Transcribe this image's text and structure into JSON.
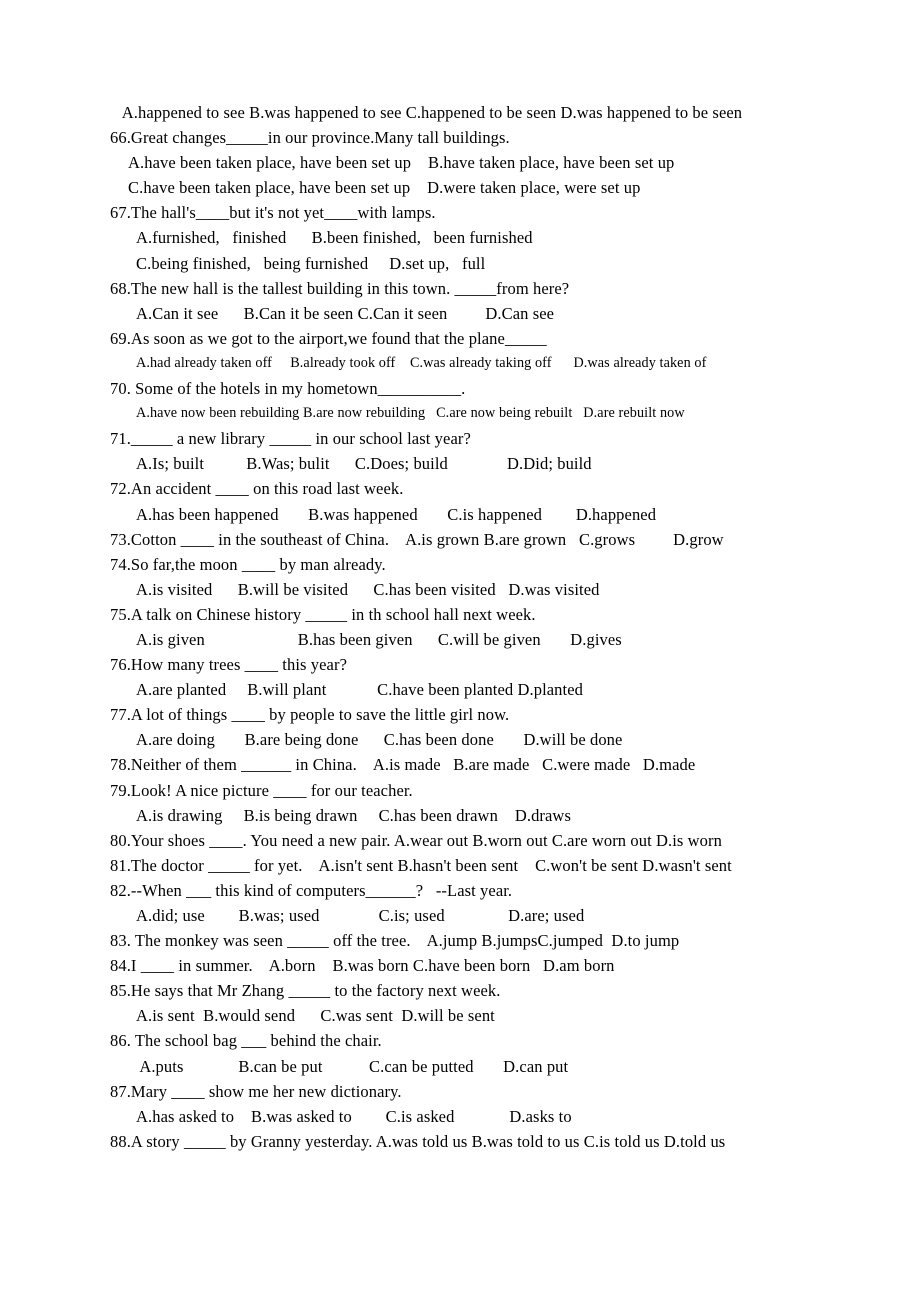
{
  "document": {
    "lines": [
      {
        "text": "   A.happened to see B.was happened to see C.happened to be seen D.was happened to be seen",
        "size": "normal",
        "indent": "none"
      },
      {
        "text": "66.Great changes_____in our province.Many tall buildings.",
        "size": "normal",
        "indent": "none"
      },
      {
        "text": "A.have been taken place, have been set up    B.have taken place, have been set up",
        "size": "normal",
        "indent": "indent1"
      },
      {
        "text": "C.have been taken place, have been set up    D.were taken place, were set up",
        "size": "normal",
        "indent": "indent1"
      },
      {
        "text": "67.The hall's____but it's not yet____with lamps.",
        "size": "normal",
        "indent": "none"
      },
      {
        "text": "A.furnished,   finished      B.been finished,   been furnished",
        "size": "normal",
        "indent": "indent2"
      },
      {
        "text": "C.being finished,   being furnished     D.set up,   full",
        "size": "normal",
        "indent": "indent2"
      },
      {
        "text": "68.The new hall is the tallest building in this town. _____from here?",
        "size": "normal",
        "indent": "none"
      },
      {
        "text": "A.Can it see      B.Can it be seen C.Can it seen         D.Can see",
        "size": "normal",
        "indent": "indent2"
      },
      {
        "text": "69.As soon as we got to the airport,we found that the plane_____",
        "size": "normal",
        "indent": "none"
      },
      {
        "text": "A.had already taken off     B.already took off    C.was already taking off      D.was already taken of",
        "size": "small",
        "indent": "indent2"
      },
      {
        "text": "70. Some of the hotels in my hometown__________.",
        "size": "normal",
        "indent": "none"
      },
      {
        "text": "A.have now been rebuilding B.are now rebuilding   C.are now being rebuilt   D.are rebuilt now",
        "size": "small",
        "indent": "indent2"
      },
      {
        "text": "71._____ a new library _____ in our school last year?",
        "size": "normal",
        "indent": "none"
      },
      {
        "text": "A.Is; built          B.Was; bulit      C.Does; build              D.Did; build",
        "size": "normal",
        "indent": "indent2"
      },
      {
        "text": "72.An accident ____ on this road last week.",
        "size": "normal",
        "indent": "none"
      },
      {
        "text": "A.has been happened       B.was happened       C.is happened        D.happened",
        "size": "normal",
        "indent": "indent2"
      },
      {
        "text": "73.Cotton ____ in the southeast of China.    A.is grown B.are grown   C.grows         D.grow",
        "size": "normal",
        "indent": "none"
      },
      {
        "text": "74.So far,the moon ____ by man already.",
        "size": "normal",
        "indent": "none"
      },
      {
        "text": "A.is visited      B.will be visited      C.has been visited   D.was visited",
        "size": "normal",
        "indent": "indent2"
      },
      {
        "text": "75.A talk on Chinese history _____ in th school hall next week.",
        "size": "normal",
        "indent": "none"
      },
      {
        "text": "A.is given                      B.has been given      C.will be given       D.gives",
        "size": "normal",
        "indent": "indent2"
      },
      {
        "text": "76.How many trees ____ this year?",
        "size": "normal",
        "indent": "none"
      },
      {
        "text": "A.are planted     B.will plant            C.have been planted D.planted",
        "size": "normal",
        "indent": "indent2"
      },
      {
        "text": "77.A lot of things ____ by people to save the little girl now.",
        "size": "normal",
        "indent": "none"
      },
      {
        "text": "A.are doing       B.are being done      C.has been done       D.will be done",
        "size": "normal",
        "indent": "indent2"
      },
      {
        "text": "78.Neither of them ______ in China.    A.is made   B.are made   C.were made   D.made",
        "size": "normal",
        "indent": "none"
      },
      {
        "text": "79.Look! A nice picture ____ for our teacher.",
        "size": "normal",
        "indent": "none"
      },
      {
        "text": "A.is drawing     B.is being drawn     C.has been drawn    D.draws",
        "size": "normal",
        "indent": "indent2"
      },
      {
        "text": "80.Your shoes ____. You need a new pair. A.wear out B.worn out C.are worn out D.is worn",
        "size": "normal",
        "indent": "none"
      },
      {
        "text": "81.The doctor _____ for yet.    A.isn't sent B.hasn't been sent    C.won't be sent D.wasn't sent",
        "size": "normal",
        "indent": "none"
      },
      {
        "text": "82.--When ___ this kind of computers______?   --Last year.",
        "size": "normal",
        "indent": "none"
      },
      {
        "text": "A.did; use        B.was; used              C.is; used               D.are; used",
        "size": "normal",
        "indent": "indent2"
      },
      {
        "text": "83. The monkey was seen _____ off the tree.    A.jump B.jumpsC.jumped  D.to jump",
        "size": "normal",
        "indent": "none"
      },
      {
        "text": "84.I ____ in summer.    A.born    B.was born C.have been born   D.am born",
        "size": "normal",
        "indent": "none"
      },
      {
        "text": "85.He says that Mr Zhang _____ to the factory next week.",
        "size": "normal",
        "indent": "none"
      },
      {
        "text": "A.is sent  B.would send      C.was sent  D.will be sent",
        "size": "normal",
        "indent": "indent2"
      },
      {
        "text": "86. The school bag ___ behind the chair.",
        "size": "normal",
        "indent": "none"
      },
      {
        "text": " A.puts             B.can be put           C.can be putted       D.can put",
        "size": "normal",
        "indent": "indent2"
      },
      {
        "text": "87.Mary ____ show me her new dictionary.",
        "size": "normal",
        "indent": "none"
      },
      {
        "text": "A.has asked to    B.was asked to        C.is asked             D.asks to",
        "size": "normal",
        "indent": "indent2"
      },
      {
        "text": "88.A story _____ by Granny yesterday. A.was told us B.was told to us C.is told us D.told us",
        "size": "normal",
        "indent": "none"
      }
    ]
  }
}
